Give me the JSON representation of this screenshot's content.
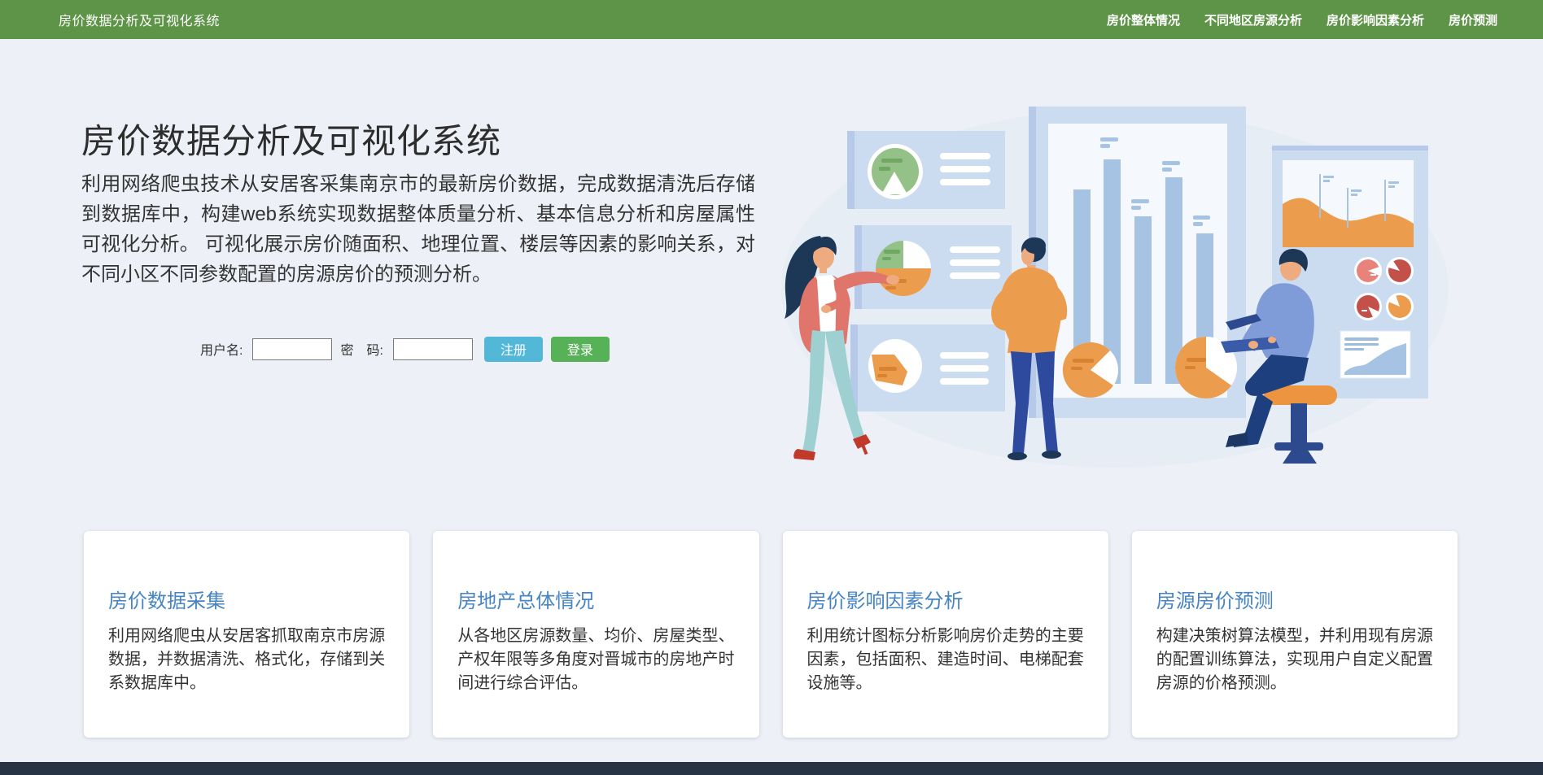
{
  "navbar": {
    "brand": "房价数据分析及可视化系统",
    "links": [
      {
        "label": "房价整体情况"
      },
      {
        "label": "不同地区房源分析"
      },
      {
        "label": "房价影响因素分析"
      },
      {
        "label": "房价预测"
      }
    ]
  },
  "hero": {
    "title": "房价数据分析及可视化系统",
    "description": "利用网络爬虫技术从安居客采集南京市的最新房价数据，完成数据清洗后存储到数据库中，构建web系统实现数据整体质量分析、基本信息分析和房屋属性可视化分析。 可视化展示房价随面积、地理位置、楼层等因素的影响关系，对不同小区不同参数配置的房源房价的预测分析。",
    "form": {
      "username_label": "用户名:",
      "password_label": "密　码:",
      "username_value": "",
      "password_value": "",
      "register_button": "注册",
      "login_button": "登录"
    }
  },
  "features": [
    {
      "title": "房价数据采集",
      "description": "利用网络爬虫从安居客抓取南京市房源数据，并数据清洗、格式化，存储到关系数据库中。"
    },
    {
      "title": "房地产总体情况",
      "description": "从各地区房源数量、均价、房屋类型、产权年限等多角度对晋城市的房地产时间进行综合评估。"
    },
    {
      "title": "房价影响因素分析",
      "description": "利用统计图标分析影响房价走势的主要因素，包括面积、建造时间、电梯配套设施等。"
    },
    {
      "title": "房源房价预测",
      "description": "构建决策树算法模型，并利用现有房源的配置训练算法，实现用户自定义配置房源的价格预测。"
    }
  ],
  "colors": {
    "navbar_green": "#5e9447",
    "register_blue": "#53b7d8",
    "login_green": "#57b257",
    "card_title_blue": "#4684c4",
    "footer_navy": "#263445",
    "panel_blue": "#cbdcf1",
    "bar_blue": "#a6c3e3",
    "accent_orange": "#ec9c4d"
  }
}
